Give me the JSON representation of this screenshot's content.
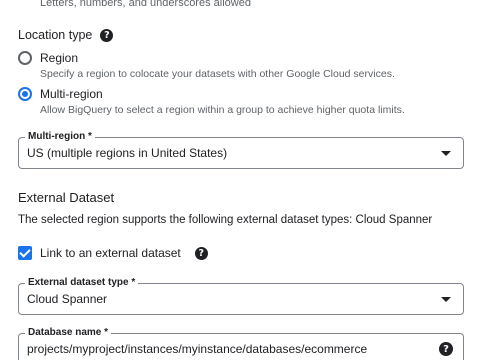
{
  "top_hint": "Letters, numbers, and underscores allowed",
  "location_type": {
    "label": "Location type",
    "help_icon": "help-circle-icon",
    "options": [
      {
        "title": "Region",
        "description": "Specify a region to colocate your datasets with other Google Cloud services.",
        "selected": false
      },
      {
        "title": "Multi-region",
        "description": "Allow BigQuery to select a region within a group to achieve higher quota limits.",
        "selected": true
      }
    ]
  },
  "multi_region": {
    "label": "Multi-region *",
    "value": "US (multiple regions in United States)"
  },
  "external_dataset": {
    "heading": "External Dataset",
    "description": "The selected region supports the following external dataset types: Cloud Spanner",
    "link_checkbox_label": "Link to an external dataset",
    "link_checked": true,
    "type_label": "External dataset type *",
    "type_value": "Cloud Spanner",
    "db_label": "Database name *",
    "db_value": "projects/myproject/instances/myinstance/databases/ecommerce"
  },
  "colors": {
    "accent": "#1a73e8",
    "text": "#202124",
    "muted": "#5f6368",
    "border": "#80868b"
  }
}
